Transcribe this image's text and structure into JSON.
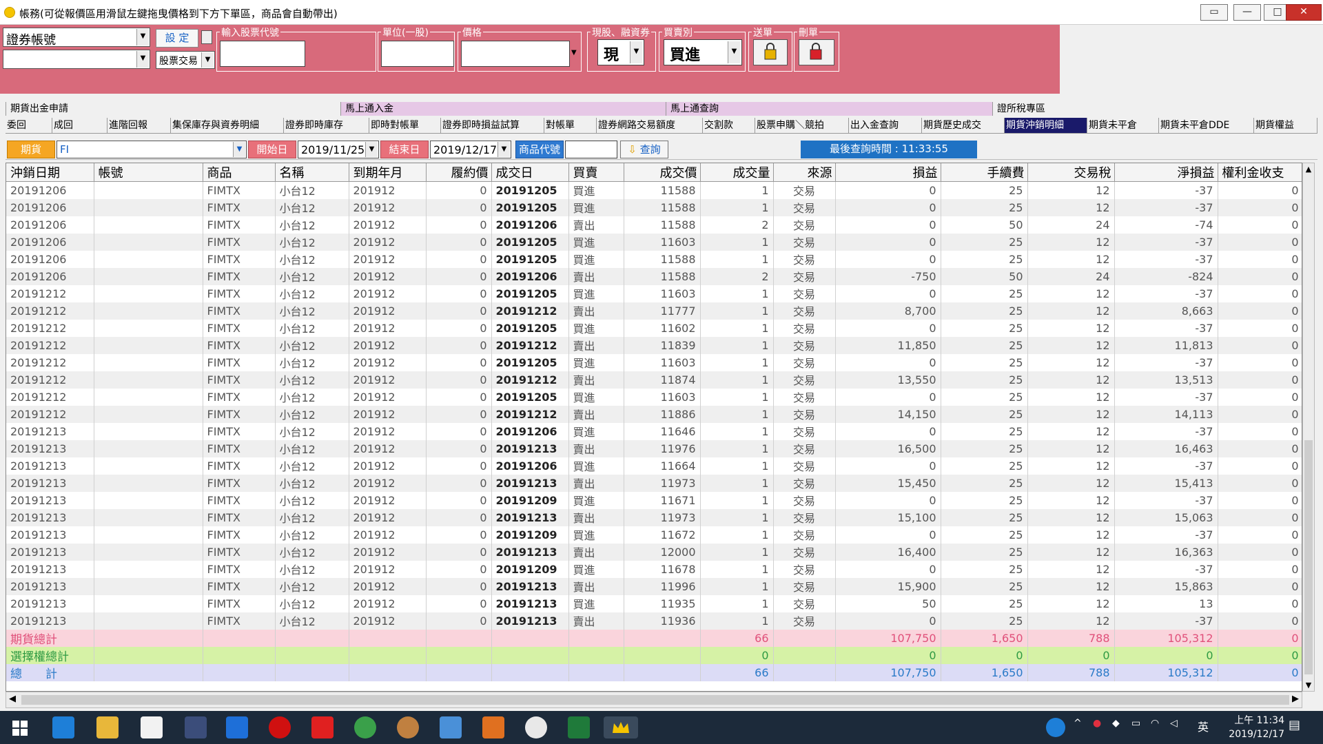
{
  "window": {
    "title": "帳務(可從報價區用滑鼠左鍵拖曳價格到下方下單區，商品會自動帶出)",
    "controls": [
      "▭",
      "—",
      "□",
      "✕"
    ]
  },
  "order_panel": {
    "account_select": "證券帳號",
    "account_sub_select": "",
    "set_button": "設 定",
    "trade_type_select": "股票交易",
    "group_stock_code": "輸入股票代號",
    "group_unit": "單位(一股)",
    "group_price": "價格",
    "group_cash_margin": "現股、融資券",
    "cash_margin_value": "現",
    "group_buy_sell": "買賣別",
    "buy_sell_value": "買進",
    "group_send": "送單",
    "group_delete": "刪單"
  },
  "function_bar": [
    "期貨出金申請",
    "馬上通入金",
    "馬上通查詢",
    "證所稅專區"
  ],
  "tabs": [
    "委回",
    "成回",
    "進階回報",
    "集保庫存與資券明細",
    "證券即時庫存",
    "即時對帳單",
    "證券即時損益試算",
    "對帳單",
    "證券網路交易額度",
    "交割款",
    "股票申購＼競拍",
    "出入金查詢",
    "期貨歷史成交",
    "期貨沖銷明細",
    "期貨未平倉",
    "期貨未平倉DDE",
    "期貨權益"
  ],
  "active_tab": "期貨沖銷明細",
  "filter": {
    "market_label": "期貨",
    "market_value": "FI",
    "start_label": "開始日",
    "start_value": "2019/11/25",
    "end_label": "結束日",
    "end_value": "2019/12/17",
    "product_label": "商品代號",
    "product_value": "",
    "query_button": "查詢",
    "last_query": "最後查詢時間 : 11:33:55"
  },
  "grid": {
    "columns": [
      "沖銷日期",
      "帳號",
      "商品",
      "名稱",
      "到期年月",
      "履約價",
      "成交日",
      "買賣",
      "成交價",
      "成交量",
      "來源",
      "損益",
      "手續費",
      "交易稅",
      "淨損益",
      "權利金收支"
    ],
    "rows": [
      [
        "20191206",
        "",
        "FIMTX",
        "小台12",
        "201912",
        "0",
        "20191205",
        "買進",
        "11588",
        "1",
        "交易",
        "0",
        "25",
        "12",
        "-37",
        "0"
      ],
      [
        "20191206",
        "",
        "FIMTX",
        "小台12",
        "201912",
        "0",
        "20191205",
        "買進",
        "11588",
        "1",
        "交易",
        "0",
        "25",
        "12",
        "-37",
        "0"
      ],
      [
        "20191206",
        "",
        "FIMTX",
        "小台12",
        "201912",
        "0",
        "20191206",
        "賣出",
        "11588",
        "2",
        "交易",
        "0",
        "50",
        "24",
        "-74",
        "0"
      ],
      [
        "20191206",
        "",
        "FIMTX",
        "小台12",
        "201912",
        "0",
        "20191205",
        "買進",
        "11603",
        "1",
        "交易",
        "0",
        "25",
        "12",
        "-37",
        "0"
      ],
      [
        "20191206",
        "",
        "FIMTX",
        "小台12",
        "201912",
        "0",
        "20191205",
        "買進",
        "11588",
        "1",
        "交易",
        "0",
        "25",
        "12",
        "-37",
        "0"
      ],
      [
        "20191206",
        "",
        "FIMTX",
        "小台12",
        "201912",
        "0",
        "20191206",
        "賣出",
        "11588",
        "2",
        "交易",
        "-750",
        "50",
        "24",
        "-824",
        "0"
      ],
      [
        "20191212",
        "",
        "FIMTX",
        "小台12",
        "201912",
        "0",
        "20191205",
        "買進",
        "11603",
        "1",
        "交易",
        "0",
        "25",
        "12",
        "-37",
        "0"
      ],
      [
        "20191212",
        "",
        "FIMTX",
        "小台12",
        "201912",
        "0",
        "20191212",
        "賣出",
        "11777",
        "1",
        "交易",
        "8,700",
        "25",
        "12",
        "8,663",
        "0"
      ],
      [
        "20191212",
        "",
        "FIMTX",
        "小台12",
        "201912",
        "0",
        "20191205",
        "買進",
        "11602",
        "1",
        "交易",
        "0",
        "25",
        "12",
        "-37",
        "0"
      ],
      [
        "20191212",
        "",
        "FIMTX",
        "小台12",
        "201912",
        "0",
        "20191212",
        "賣出",
        "11839",
        "1",
        "交易",
        "11,850",
        "25",
        "12",
        "11,813",
        "0"
      ],
      [
        "20191212",
        "",
        "FIMTX",
        "小台12",
        "201912",
        "0",
        "20191205",
        "買進",
        "11603",
        "1",
        "交易",
        "0",
        "25",
        "12",
        "-37",
        "0"
      ],
      [
        "20191212",
        "",
        "FIMTX",
        "小台12",
        "201912",
        "0",
        "20191212",
        "賣出",
        "11874",
        "1",
        "交易",
        "13,550",
        "25",
        "12",
        "13,513",
        "0"
      ],
      [
        "20191212",
        "",
        "FIMTX",
        "小台12",
        "201912",
        "0",
        "20191205",
        "買進",
        "11603",
        "1",
        "交易",
        "0",
        "25",
        "12",
        "-37",
        "0"
      ],
      [
        "20191212",
        "",
        "FIMTX",
        "小台12",
        "201912",
        "0",
        "20191212",
        "賣出",
        "11886",
        "1",
        "交易",
        "14,150",
        "25",
        "12",
        "14,113",
        "0"
      ],
      [
        "20191213",
        "",
        "FIMTX",
        "小台12",
        "201912",
        "0",
        "20191206",
        "買進",
        "11646",
        "1",
        "交易",
        "0",
        "25",
        "12",
        "-37",
        "0"
      ],
      [
        "20191213",
        "",
        "FIMTX",
        "小台12",
        "201912",
        "0",
        "20191213",
        "賣出",
        "11976",
        "1",
        "交易",
        "16,500",
        "25",
        "12",
        "16,463",
        "0"
      ],
      [
        "20191213",
        "",
        "FIMTX",
        "小台12",
        "201912",
        "0",
        "20191206",
        "買進",
        "11664",
        "1",
        "交易",
        "0",
        "25",
        "12",
        "-37",
        "0"
      ],
      [
        "20191213",
        "",
        "FIMTX",
        "小台12",
        "201912",
        "0",
        "20191213",
        "賣出",
        "11973",
        "1",
        "交易",
        "15,450",
        "25",
        "12",
        "15,413",
        "0"
      ],
      [
        "20191213",
        "",
        "FIMTX",
        "小台12",
        "201912",
        "0",
        "20191209",
        "買進",
        "11671",
        "1",
        "交易",
        "0",
        "25",
        "12",
        "-37",
        "0"
      ],
      [
        "20191213",
        "",
        "FIMTX",
        "小台12",
        "201912",
        "0",
        "20191213",
        "賣出",
        "11973",
        "1",
        "交易",
        "15,100",
        "25",
        "12",
        "15,063",
        "0"
      ],
      [
        "20191213",
        "",
        "FIMTX",
        "小台12",
        "201912",
        "0",
        "20191209",
        "買進",
        "11672",
        "1",
        "交易",
        "0",
        "25",
        "12",
        "-37",
        "0"
      ],
      [
        "20191213",
        "",
        "FIMTX",
        "小台12",
        "201912",
        "0",
        "20191213",
        "賣出",
        "12000",
        "1",
        "交易",
        "16,400",
        "25",
        "12",
        "16,363",
        "0"
      ],
      [
        "20191213",
        "",
        "FIMTX",
        "小台12",
        "201912",
        "0",
        "20191209",
        "買進",
        "11678",
        "1",
        "交易",
        "0",
        "25",
        "12",
        "-37",
        "0"
      ],
      [
        "20191213",
        "",
        "FIMTX",
        "小台12",
        "201912",
        "0",
        "20191213",
        "賣出",
        "11996",
        "1",
        "交易",
        "15,900",
        "25",
        "12",
        "15,863",
        "0"
      ],
      [
        "20191213",
        "",
        "FIMTX",
        "小台12",
        "201912",
        "0",
        "20191213",
        "買進",
        "11935",
        "1",
        "交易",
        "50",
        "25",
        "12",
        "13",
        "0"
      ],
      [
        "20191213",
        "",
        "FIMTX",
        "小台12",
        "201912",
        "0",
        "20191213",
        "賣出",
        "11936",
        "1",
        "交易",
        "0",
        "25",
        "12",
        "-37",
        "0"
      ]
    ],
    "totals": [
      {
        "label": "期貨總計",
        "qty": "66",
        "pnl": "107,750",
        "fee": "1,650",
        "tax": "788",
        "net": "105,312",
        "premium": "0",
        "style": "tot1"
      },
      {
        "label": "選擇權總計",
        "qty": "0",
        "pnl": "0",
        "fee": "0",
        "tax": "0",
        "net": "0",
        "premium": "0",
        "style": "tot2"
      },
      {
        "label": "總　　計",
        "qty": "66",
        "pnl": "107,750",
        "fee": "1,650",
        "tax": "788",
        "net": "105,312",
        "premium": "0",
        "style": "tot3"
      }
    ]
  },
  "taskbar": {
    "ime": "英",
    "time": "上午 11:34",
    "date": "2019/12/17"
  }
}
